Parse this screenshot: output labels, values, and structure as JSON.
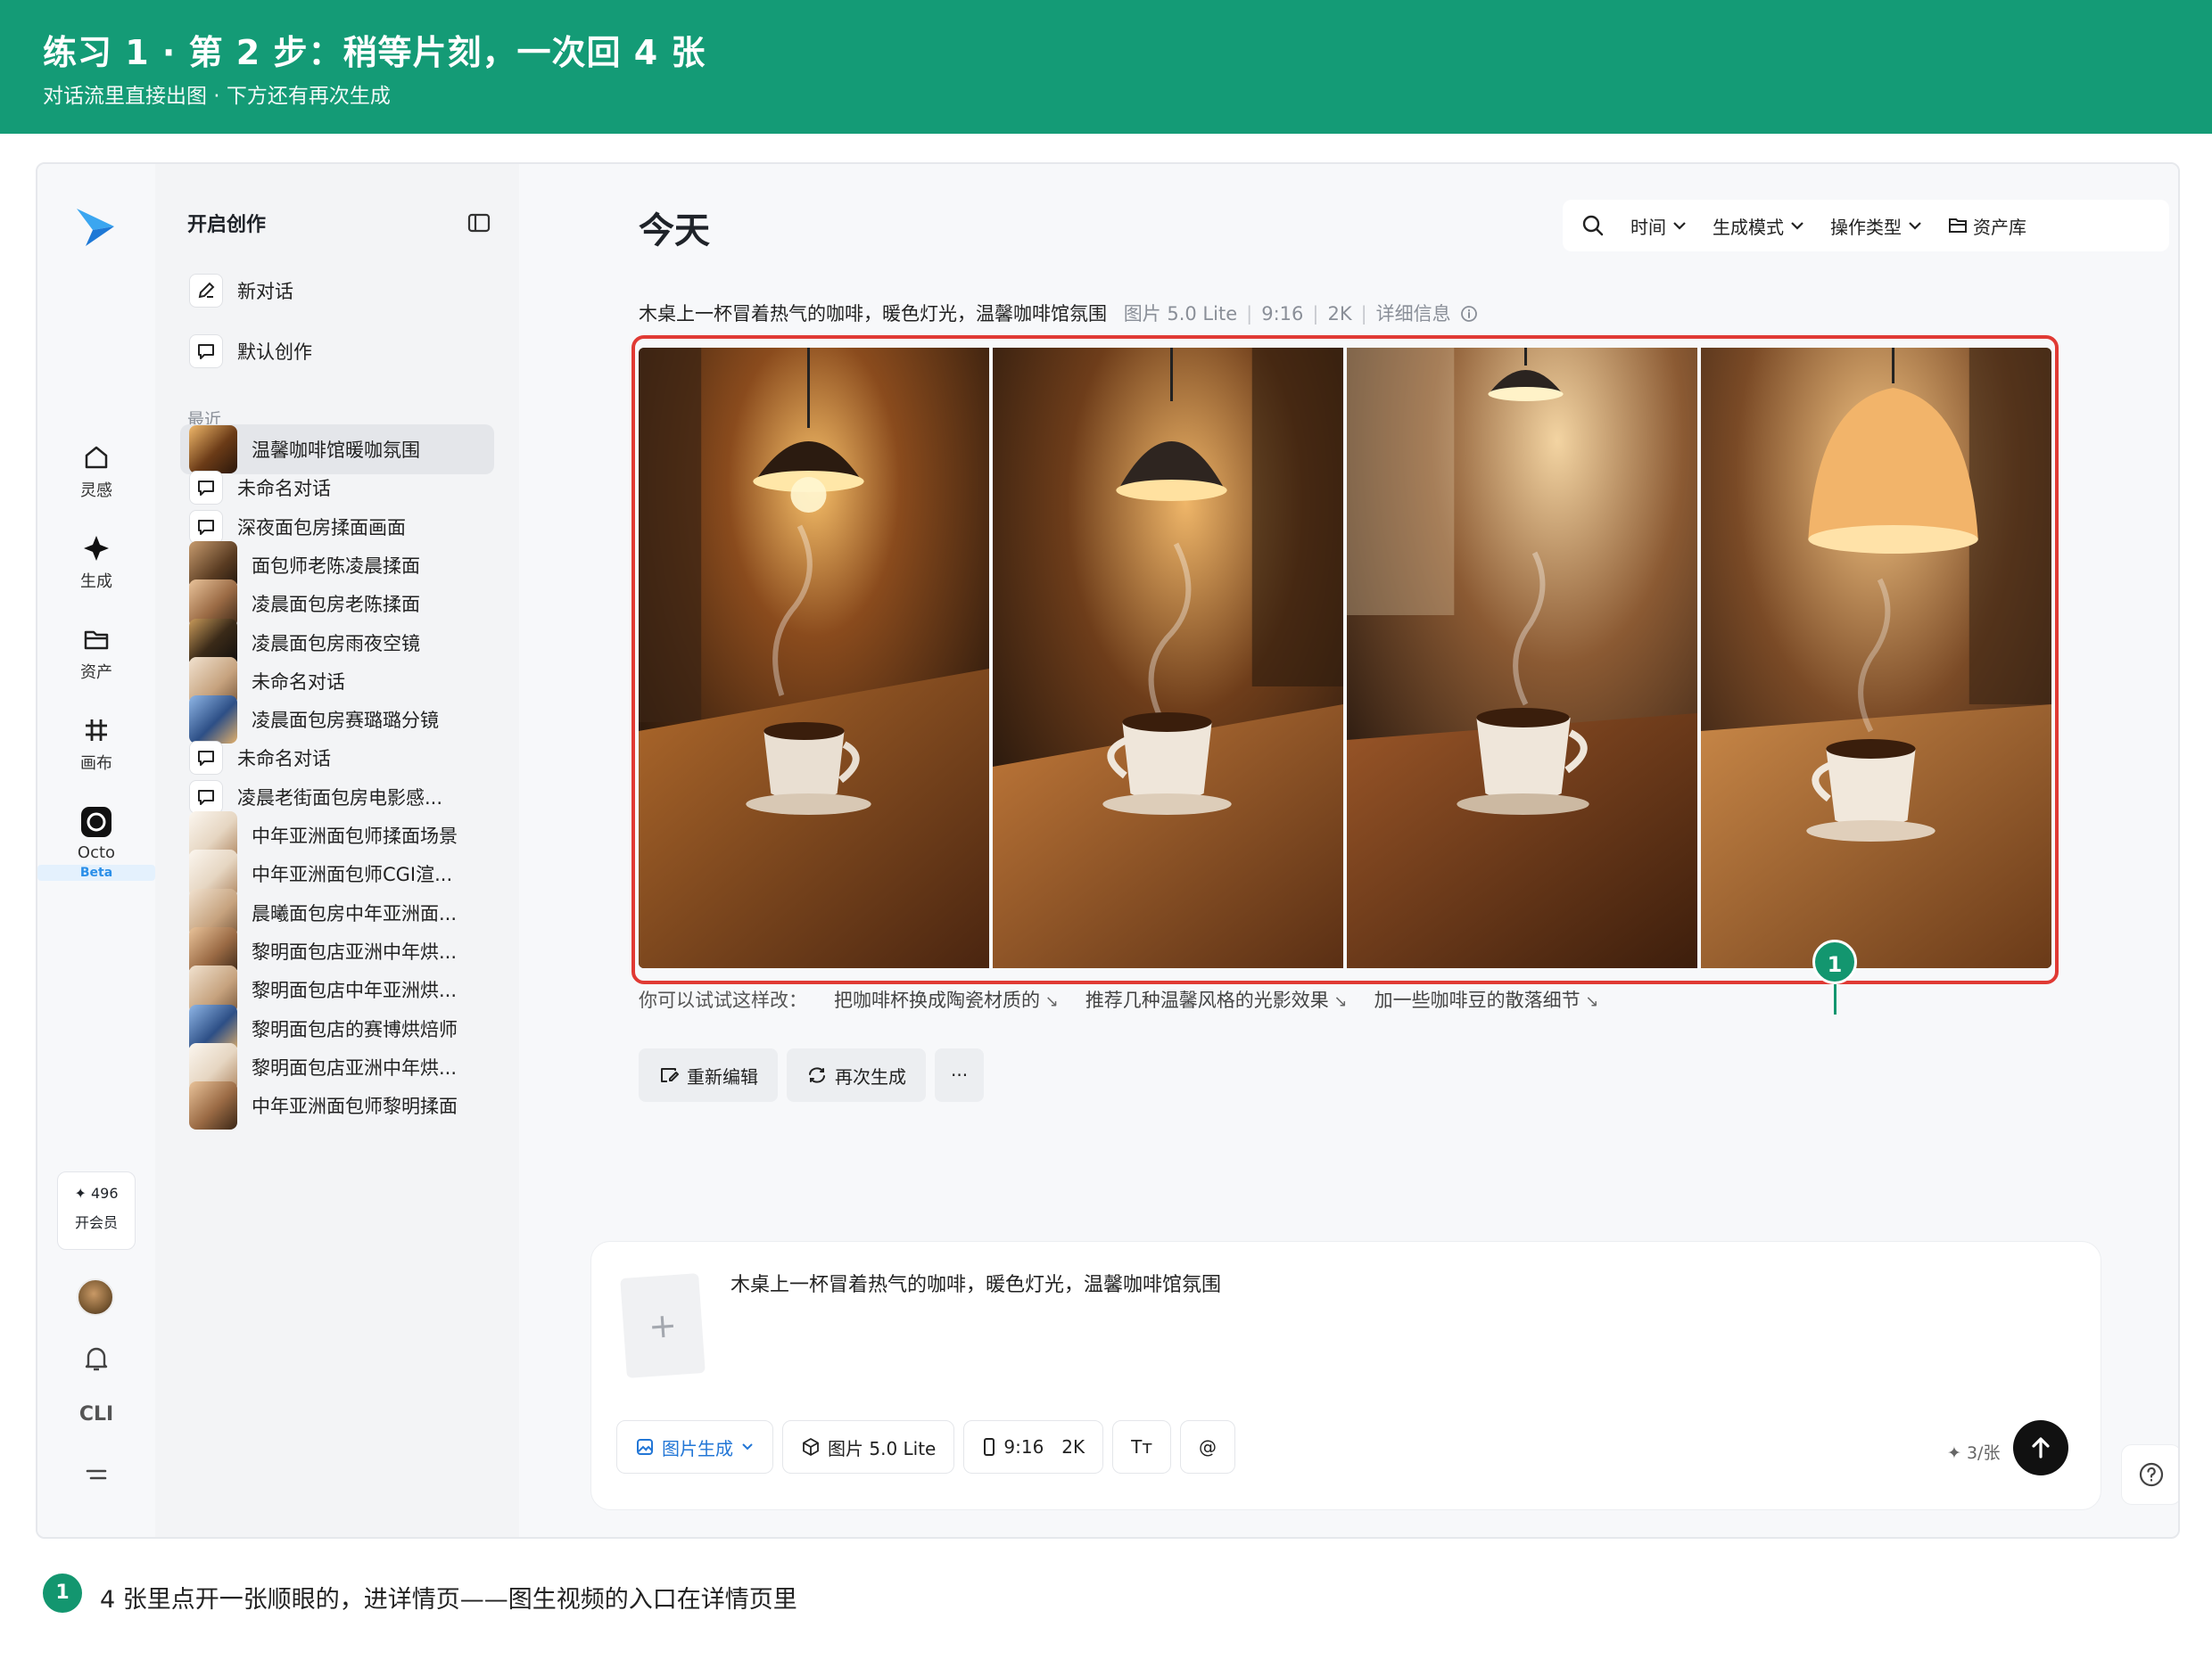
{
  "banner": {
    "title": "练习 1 · 第 2 步：稍等片刻，一次回 4 张",
    "subtitle": "对话流里直接出图 · 下方还有再次生成"
  },
  "rail": {
    "items": [
      {
        "label": "灵感",
        "icon": "home-icon"
      },
      {
        "label": "生成",
        "icon": "sparkle-icon"
      },
      {
        "label": "资产",
        "icon": "folder-icon"
      },
      {
        "label": "画布",
        "icon": "grid-icon"
      },
      {
        "label": "Octo",
        "icon": "octo-icon"
      }
    ],
    "octo_badge": "Beta",
    "points": "496",
    "member_label": "开会员",
    "cli_label": "CLI"
  },
  "sidebar": {
    "title": "开启创作",
    "top_items": [
      {
        "label": "新对话",
        "icon": "edit-icon"
      },
      {
        "label": "默认创作",
        "icon": "chat-icon"
      }
    ],
    "recent_label": "最近",
    "recent": [
      {
        "label": "温馨咖啡馆暖咖氛围",
        "thumb": "cafe",
        "active": true
      },
      {
        "label": "未命名对话",
        "thumb": "chat"
      },
      {
        "label": "深夜面包房揉面画面",
        "thumb": "chat"
      },
      {
        "label": "面包师老陈凌晨揉面",
        "thumb": "baker-dark"
      },
      {
        "label": "凌晨面包房老陈揉面",
        "thumb": "baker-warm"
      },
      {
        "label": "凌晨面包房雨夜空镜",
        "thumb": "night"
      },
      {
        "label": "未命名对话",
        "thumb": "baker-light"
      },
      {
        "label": "凌晨面包房赛璐璐分镜",
        "thumb": "anime"
      },
      {
        "label": "未命名对话",
        "thumb": "chat"
      },
      {
        "label": "凌晨老街面包房电影感...",
        "thumb": "chat"
      },
      {
        "label": "中年亚洲面包师揉面场景",
        "thumb": "baker-white"
      },
      {
        "label": "中年亚洲面包师CGI渲...",
        "thumb": "baker-white"
      },
      {
        "label": "晨曦面包房中年亚洲面...",
        "thumb": "baker-light"
      },
      {
        "label": "黎明面包店亚洲中年烘...",
        "thumb": "baker-warm"
      },
      {
        "label": "黎明面包店中年亚洲烘...",
        "thumb": "baker-light"
      },
      {
        "label": "黎明面包店的赛博烘焙师",
        "thumb": "anime"
      },
      {
        "label": "黎明面包店亚洲中年烘...",
        "thumb": "baker-white"
      },
      {
        "label": "中年亚洲面包师黎明揉面",
        "thumb": "baker-warm"
      }
    ]
  },
  "main": {
    "title": "今天",
    "toolbar": {
      "time": "时间",
      "mode": "生成模式",
      "op_type": "操作类型",
      "library": "资产库"
    },
    "prompt": "木桌上一杯冒着热气的咖啡，暖色灯光，温馨咖啡馆氛围",
    "meta": {
      "model": "图片 5.0 Lite",
      "ratio": "9:16",
      "resolution": "2K",
      "details": "详细信息"
    },
    "images": [
      {
        "alt": "咖啡图 1"
      },
      {
        "alt": "咖啡图 2"
      },
      {
        "alt": "咖啡图 3"
      },
      {
        "alt": "咖啡图 4"
      }
    ],
    "step_badge": "1",
    "suggest_label": "你可以试试这样改：",
    "suggestions": [
      "把咖啡杯换成陶瓷材质的",
      "推荐几种温馨风格的光影效果",
      "加一些咖啡豆的散落细节"
    ],
    "actions": {
      "reedit": "重新编辑",
      "regenerate": "再次生成",
      "more": "···"
    },
    "composer": {
      "text": "木桌上一杯冒着热气的咖啡，暖色灯光，温馨咖啡馆氛围",
      "upload_plus": "+",
      "mode": "图片生成",
      "model": "图片 5.0 Lite",
      "ratio": "9:16",
      "resolution": "2K",
      "text_icon": "Tт",
      "mention": "@",
      "cost": "3/张"
    }
  },
  "footnote": {
    "badge": "1",
    "text": "4 张里点开一张顺眼的，进详情页——图生视频的入口在详情页里"
  },
  "colors": {
    "banner": "#149b76",
    "highlight": "#e03a34",
    "accent_blue": "#2276d6"
  }
}
